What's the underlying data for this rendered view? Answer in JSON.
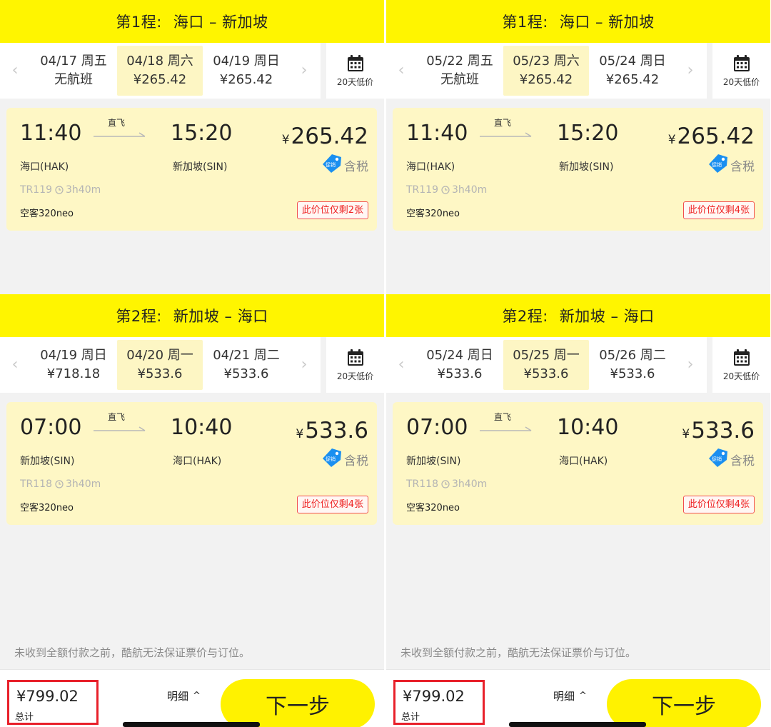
{
  "panels": [
    {
      "legs": [
        {
          "label": "第1程:",
          "route": "海口 – 新加坡",
          "dates": [
            {
              "date": "04/17 周五",
              "price": "无航班"
            },
            {
              "date": "04/18 周六",
              "price": "¥265.42"
            },
            {
              "date": "04/19 周日",
              "price": "¥265.42"
            }
          ],
          "selected_index": 1,
          "calendar_label": "20天低价",
          "flight": {
            "dep_time": "11:40",
            "arr_time": "15:20",
            "direct": "直飞",
            "dep_airport": "海口(HAK)",
            "arr_airport": "新加坡(SIN)",
            "currency": "¥",
            "price": "265.42",
            "promo": "促销",
            "tax": "含税",
            "flight_no": "TR119",
            "duration": "3h40m",
            "aircraft": "空客320neo",
            "remaining": "此价位仅剩2张"
          }
        },
        {
          "label": "第2程:",
          "route": "新加坡 – 海口",
          "dates": [
            {
              "date": "04/19 周日",
              "price": "¥718.18"
            },
            {
              "date": "04/20 周一",
              "price": "¥533.6"
            },
            {
              "date": "04/21 周二",
              "price": "¥533.6"
            }
          ],
          "selected_index": 1,
          "calendar_label": "20天低价",
          "flight": {
            "dep_time": "07:00",
            "arr_time": "10:40",
            "direct": "直飞",
            "dep_airport": "新加坡(SIN)",
            "arr_airport": "海口(HAK)",
            "currency": "¥",
            "price": "533.6",
            "promo": "促销",
            "tax": "含税",
            "flight_no": "TR118",
            "duration": "3h40m",
            "aircraft": "空客320neo",
            "remaining": "此价位仅剩4张"
          }
        }
      ],
      "notice": "未收到全额付款之前，酷航无法保证票价与订位。",
      "total_amount": "¥799.02",
      "total_label": "总计",
      "detail_label": "明细",
      "next_label": "下一步"
    },
    {
      "legs": [
        {
          "label": "第1程:",
          "route": "海口 – 新加坡",
          "dates": [
            {
              "date": "05/22 周五",
              "price": "无航班"
            },
            {
              "date": "05/23 周六",
              "price": "¥265.42"
            },
            {
              "date": "05/24 周日",
              "price": "¥265.42"
            }
          ],
          "selected_index": 1,
          "calendar_label": "20天低价",
          "flight": {
            "dep_time": "11:40",
            "arr_time": "15:20",
            "direct": "直飞",
            "dep_airport": "海口(HAK)",
            "arr_airport": "新加坡(SIN)",
            "currency": "¥",
            "price": "265.42",
            "promo": "促销",
            "tax": "含税",
            "flight_no": "TR119",
            "duration": "3h40m",
            "aircraft": "空客320neo",
            "remaining": "此价位仅剩4张"
          }
        },
        {
          "label": "第2程:",
          "route": "新加坡 – 海口",
          "dates": [
            {
              "date": "05/24 周日",
              "price": "¥533.6"
            },
            {
              "date": "05/25 周一",
              "price": "¥533.6"
            },
            {
              "date": "05/26 周二",
              "price": "¥533.6"
            }
          ],
          "selected_index": 1,
          "calendar_label": "20天低价",
          "flight": {
            "dep_time": "07:00",
            "arr_time": "10:40",
            "direct": "直飞",
            "dep_airport": "新加坡(SIN)",
            "arr_airport": "海口(HAK)",
            "currency": "¥",
            "price": "533.6",
            "promo": "促销",
            "tax": "含税",
            "flight_no": "TR118",
            "duration": "3h40m",
            "aircraft": "空客320neo",
            "remaining": "此价位仅剩4张"
          }
        }
      ],
      "notice": "未收到全额付款之前，酷航无法保证票价与订位。",
      "total_amount": "¥799.02",
      "total_label": "总计",
      "detail_label": "明细",
      "next_label": "下一步"
    }
  ],
  "colors": {
    "brand_yellow": "#fff500",
    "selected_date_bg": "#fdf6c4",
    "card_bg": "#fef7c5",
    "alert_red": "#ee2222",
    "promo_blue": "#1a8ff0"
  },
  "icons": [
    "calendar-icon",
    "chevron-left-icon",
    "chevron-right-icon",
    "arrow-icon",
    "promo-tag-icon",
    "clock-icon",
    "caret-up-icon"
  ]
}
